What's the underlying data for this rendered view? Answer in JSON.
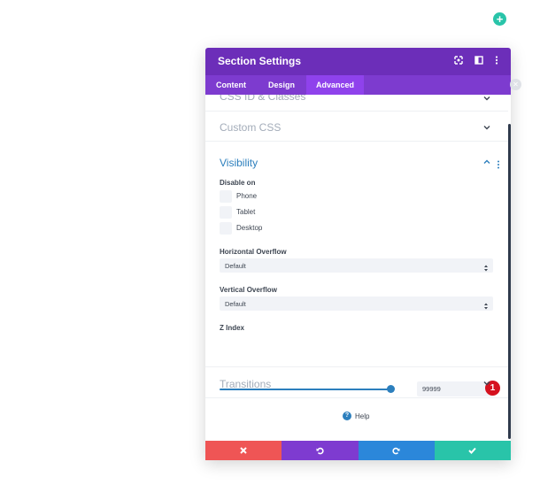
{
  "modal": {
    "title": "Section Settings",
    "colors": {
      "header": "#6c2eb9",
      "tabs": "#7d3bcf",
      "active_tab": "#8f42ec",
      "accent": "#2c7fbd"
    },
    "header_icons": [
      "expand-icon",
      "columns-icon",
      "more-icon"
    ]
  },
  "tabs": [
    {
      "label": "Content",
      "active": false
    },
    {
      "label": "Design",
      "active": false
    },
    {
      "label": "Advanced",
      "active": true
    }
  ],
  "sections": {
    "css_id_classes": {
      "title": "CSS ID & Classes"
    },
    "custom_css": {
      "title": "Custom CSS"
    },
    "visibility": {
      "title": "Visibility",
      "disable_on_label": "Disable on",
      "options": [
        {
          "label": "Phone",
          "checked": false
        },
        {
          "label": "Tablet",
          "checked": false
        },
        {
          "label": "Desktop",
          "checked": false
        }
      ],
      "horizontal_overflow": {
        "label": "Horizontal Overflow",
        "value": "Default"
      },
      "vertical_overflow": {
        "label": "Vertical Overflow",
        "value": "Default"
      },
      "z_index": {
        "label": "Z Index",
        "value": "99999",
        "slider_fraction": 1.0,
        "badge": "1"
      }
    },
    "transitions": {
      "title": "Transitions"
    }
  },
  "help": {
    "label": "Help"
  },
  "footer": {
    "buttons": [
      {
        "name": "discard",
        "icon": "close-icon",
        "color": "#ef5555"
      },
      {
        "name": "undo",
        "icon": "undo-icon",
        "color": "#7e3bd0"
      },
      {
        "name": "redo",
        "icon": "redo-icon",
        "color": "#2b87da"
      },
      {
        "name": "save",
        "icon": "check-icon",
        "color": "#29c4a9"
      }
    ]
  }
}
